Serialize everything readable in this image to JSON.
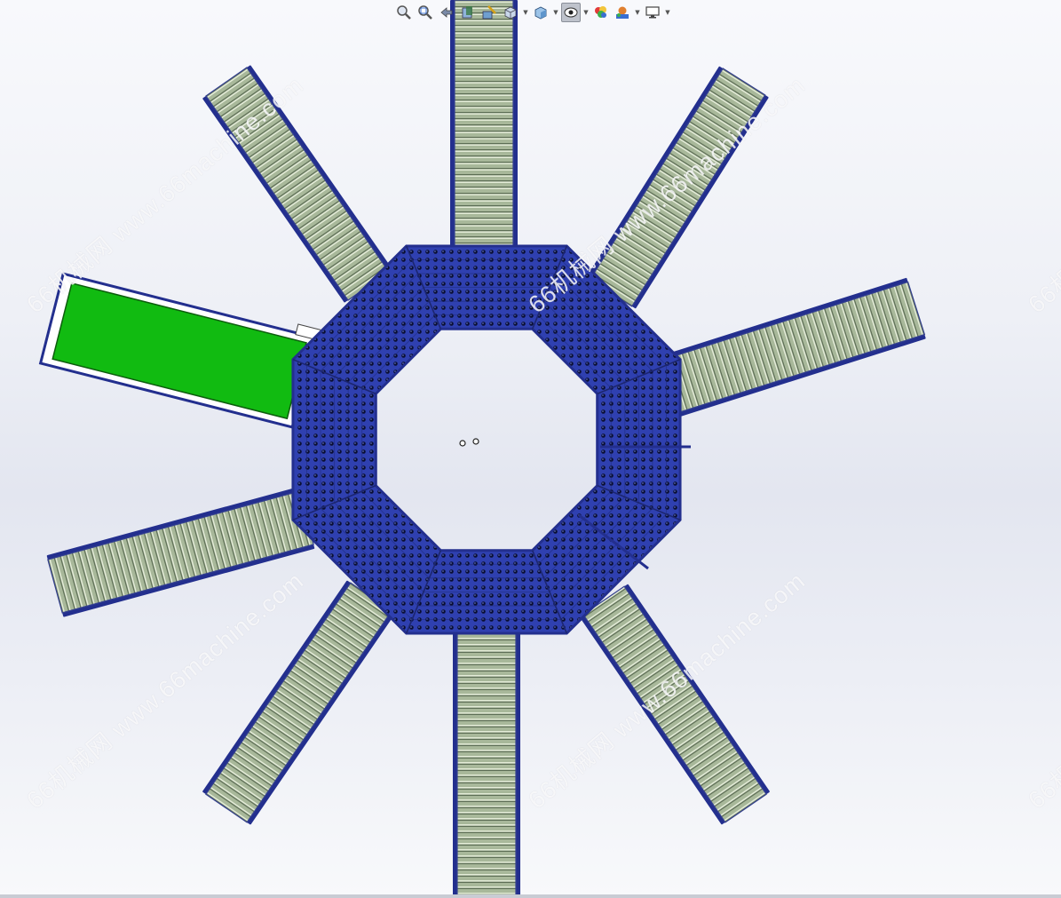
{
  "app": {
    "name": "SolidWorks graphics area",
    "view": "top view assembly"
  },
  "toolbar": {
    "buttons": [
      {
        "name": "zoom-to-fit",
        "icon": "zoom-fit-icon",
        "dropdown": false
      },
      {
        "name": "zoom-to-area",
        "icon": "zoom-area-icon",
        "dropdown": false
      },
      {
        "name": "previous-view",
        "icon": "previous-view-icon",
        "dropdown": false
      },
      {
        "name": "section-view",
        "icon": "section-view-icon",
        "dropdown": false
      },
      {
        "name": "dynamic-annotation",
        "icon": "annotation-view-icon",
        "dropdown": false
      },
      {
        "name": "view-orientation",
        "icon": "view-orientation-icon",
        "dropdown": true
      },
      {
        "name": "display-style",
        "icon": "display-style-icon",
        "dropdown": true
      },
      {
        "name": "hide-show-items",
        "icon": "hide-show-icon",
        "dropdown": true,
        "active": true
      },
      {
        "name": "edit-appearance",
        "icon": "appearance-icon",
        "dropdown": false
      },
      {
        "name": "apply-scene",
        "icon": "scene-icon",
        "dropdown": true
      },
      {
        "name": "view-settings",
        "icon": "monitor-icon",
        "dropdown": true
      }
    ]
  },
  "watermark": {
    "text": "66机械网 www.66machine.com",
    "short": "66机械网"
  },
  "model": {
    "hub_color": "#2f40b0",
    "frame_color": "#232f8e",
    "roller_color": "#a8b89a",
    "roller_stripe": "#6f8064",
    "green_conveyor_color": "#11bb11",
    "rollers_per_conveyor": 38,
    "hub_rows": 6
  }
}
